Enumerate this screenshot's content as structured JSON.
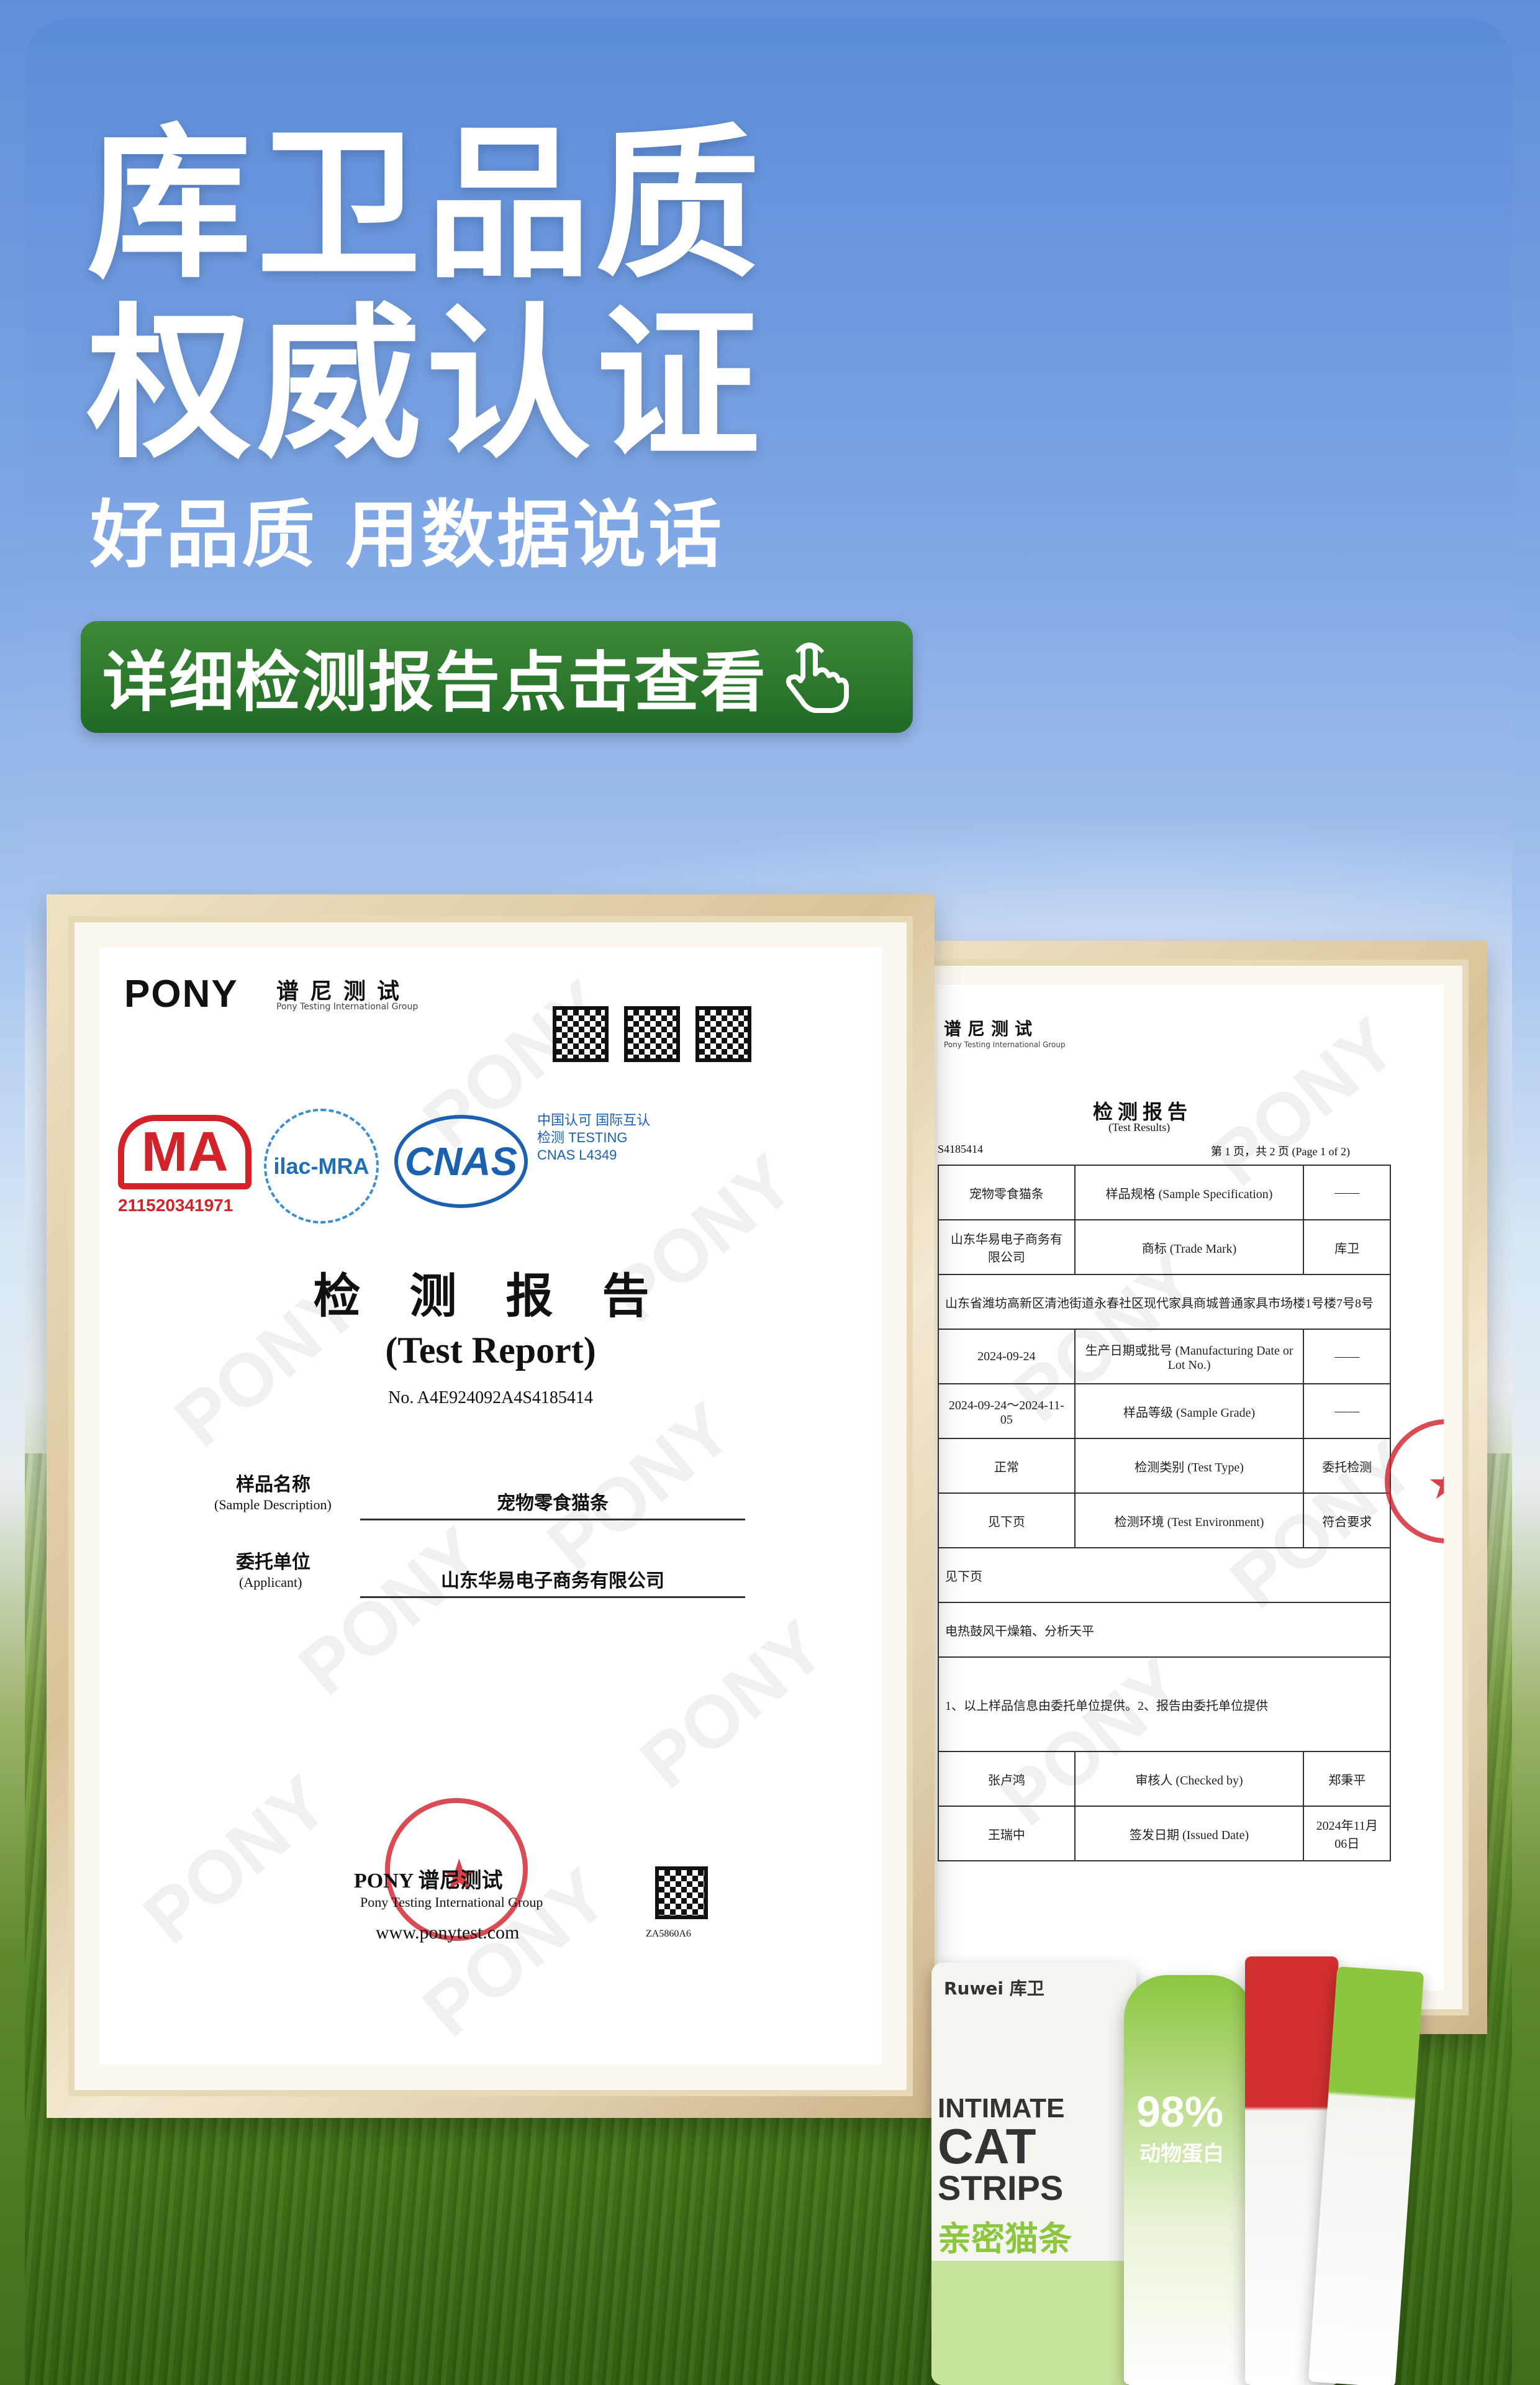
{
  "header": {
    "title_line1": "库卫品质",
    "title_line2": "权威认证",
    "subtitle": "好品质 用数据说话"
  },
  "cta": {
    "label": "详细检测报告点击查看",
    "icon": "hand-pointer-icon"
  },
  "certificate_front": {
    "brand": "PONY",
    "brand_cn": "谱尼测试",
    "brand_sub": "Pony Testing International Group",
    "ma_code": "211520341971",
    "ilac_label": "ilac-MRA",
    "cnas_label": "CNAS",
    "cnas_note": "中国认可 国际互认 检测 TESTING CNAS L4349",
    "report_title": "检 测 报 告",
    "report_title_en": "(Test Report)",
    "report_no": "No. A4E924092A4S4185414",
    "sample_label": "样品名称",
    "sample_label_en": "(Sample Description)",
    "sample_value": "宠物零食猫条",
    "applicant_label": "委托单位",
    "applicant_label_en": "(Applicant)",
    "applicant_value": "山东华易电子商务有限公司",
    "footer_brand": "PONY 谱尼测试",
    "footer_sub": "Pony Testing International Group",
    "website": "www.ponytest.com",
    "code_small": "ZA5860A6"
  },
  "certificate_back": {
    "brand_cn": "谱尼测试",
    "brand_sub": "Pony Testing International Group",
    "report_title": "检 测 报 告",
    "report_title_en": "(Test Results)",
    "report_code": "S4185414",
    "page_info": "第 1 页，共 2 页 (Page 1 of 2)",
    "rows": [
      [
        "宠物零食猫条",
        "样品规格 (Sample Specification)",
        "——"
      ],
      [
        "山东华易电子商务有限公司",
        "商标 (Trade Mark)",
        "库卫"
      ],
      [
        "山东省潍坊高新区清池街道永春社区现代家具商城普通家具市场楼1号楼7号8号",
        "",
        ""
      ],
      [
        "2024-09-24",
        "生产日期或批号 (Manufacturing Date or Lot No.)",
        "——"
      ],
      [
        "2024-09-24～2024-11-05",
        "样品等级 (Sample Grade)",
        "——"
      ],
      [
        "正常",
        "检测类别 (Test Type)",
        "委托检测"
      ],
      [
        "见下页",
        "检测环境 (Test Environment)",
        "符合要求"
      ],
      [
        "见下页",
        "",
        ""
      ],
      [
        "电热鼓风干燥箱、分析天平",
        "",
        ""
      ],
      [
        "1、以上样品信息由委托单位提供。2、报告由委托单位提供",
        "",
        ""
      ],
      [
        "张卢鸿",
        "审核人 (Checked by)",
        "郑秉平"
      ],
      [
        "王瑞中",
        "签发日期 (Issued Date)",
        "2024年11月06日"
      ]
    ]
  },
  "product": {
    "brand": "Ruwei 库卫",
    "line1": "INTIMATE",
    "line2": "CAT",
    "line3": "STRIPS",
    "name_cn": "亲密猫条",
    "protein": "98%",
    "protein_label": "动物蛋白"
  },
  "colors": {
    "title": "#ffffff",
    "cta_bg": "#2a7a2e",
    "frame": "#e2cfa6",
    "stamp": "#d21e28",
    "product_green": "#8cc63f",
    "product_red": "#d32f2f"
  }
}
